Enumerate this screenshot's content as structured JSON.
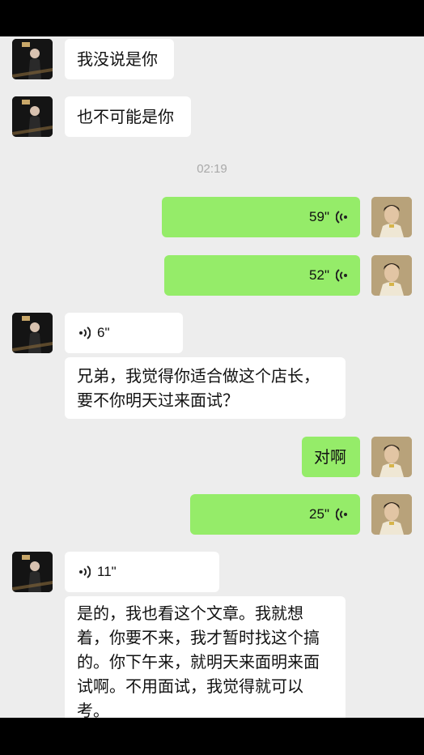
{
  "timestamp": "02:19",
  "messages": [
    {
      "type": "text",
      "side": "left",
      "text": "我没说是你"
    },
    {
      "type": "text",
      "side": "left",
      "text": "也不可能是你"
    },
    {
      "type": "voice",
      "side": "right",
      "duration": "59\""
    },
    {
      "type": "voice",
      "side": "right",
      "duration": "52\""
    },
    {
      "type": "voice",
      "side": "left",
      "duration": "6\""
    },
    {
      "type": "text",
      "side": "left",
      "lines": [
        "兄弟，我觉得你适合做这个店长，",
        "要不你明天过来面试？"
      ]
    },
    {
      "type": "text",
      "side": "right",
      "text": "对啊"
    },
    {
      "type": "voice",
      "side": "right",
      "duration": "25\""
    },
    {
      "type": "voice",
      "side": "left",
      "duration": "11\""
    },
    {
      "type": "text",
      "side": "left",
      "lines": [
        "是的，我也看这个文章。我就想",
        "着，你要不来，我才暂时找这个搞",
        "的。你下午来，就明天来面明来面",
        "试啊。不用面试，我觉得就可以",
        "考。"
      ]
    }
  ],
  "icons": {
    "voice_received": "voice-wave-left-icon",
    "voice_sent": "voice-wave-right-icon",
    "avatar_contact": "contact-avatar",
    "avatar_self": "self-avatar"
  },
  "colors": {
    "chat_background": "#ededed",
    "sent_bubble": "#95ec69",
    "received_bubble": "#ffffff",
    "timestamp": "#a9a9a9"
  }
}
